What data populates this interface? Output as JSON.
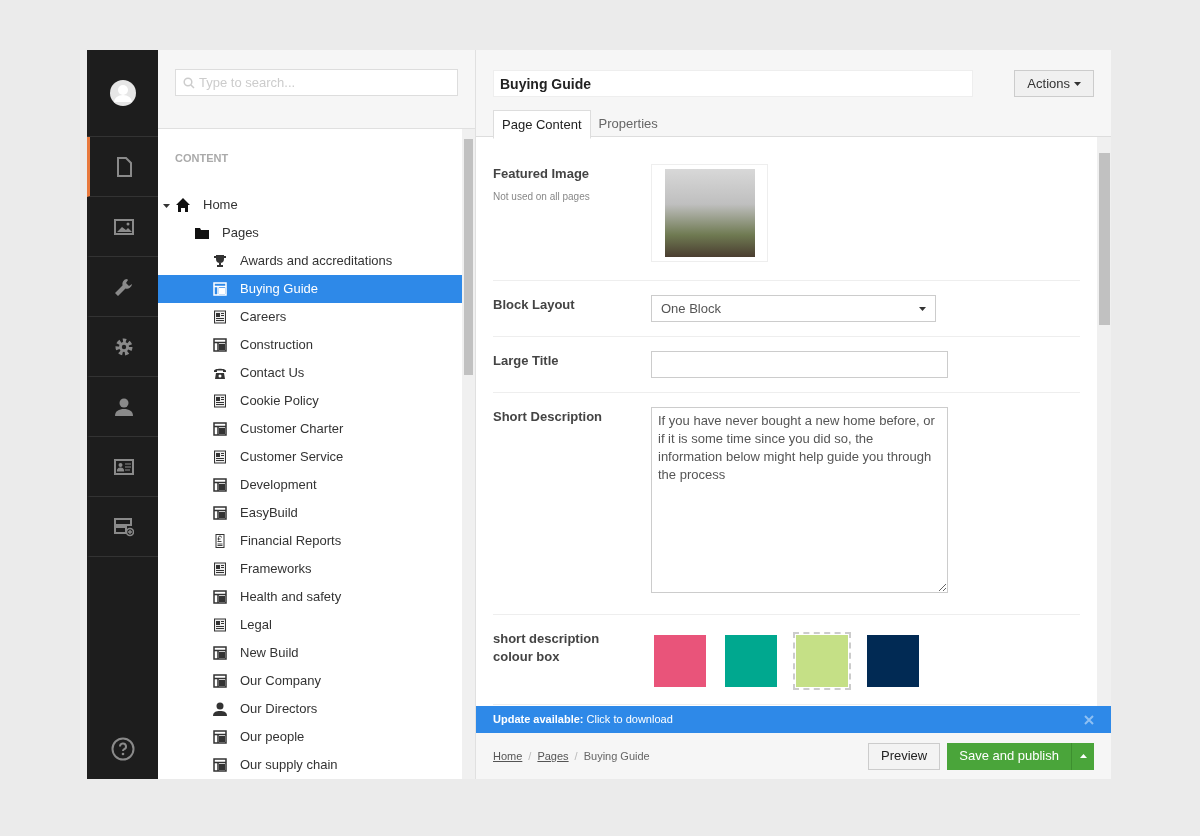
{
  "sidebar": {
    "sections": [
      {
        "kind": "document",
        "selected": true
      },
      {
        "kind": "image",
        "selected": false
      },
      {
        "kind": "wrench",
        "selected": false
      },
      {
        "kind": "gear",
        "selected": false
      },
      {
        "kind": "person",
        "selected": false
      },
      {
        "kind": "card",
        "selected": false
      },
      {
        "kind": "server",
        "selected": false
      }
    ]
  },
  "search": {
    "placeholder": "Type to search..."
  },
  "tree": {
    "heading": "CONTENT",
    "items": [
      {
        "label": "Home",
        "kind": "home",
        "expanded": true,
        "selected": false,
        "children": [
          {
            "label": "Pages",
            "kind": "folder",
            "selected": false,
            "children": [
              {
                "label": "Awards and accreditations",
                "kind": "trophy",
                "selected": false
              },
              {
                "label": "Buying Guide",
                "kind": "layout",
                "selected": true
              },
              {
                "label": "Careers",
                "kind": "article",
                "selected": false
              },
              {
                "label": "Construction",
                "kind": "layout",
                "selected": false
              },
              {
                "label": "Contact Us",
                "kind": "phone",
                "selected": false
              },
              {
                "label": "Cookie Policy",
                "kind": "article",
                "selected": false
              },
              {
                "label": "Customer Charter",
                "kind": "layout",
                "selected": false
              },
              {
                "label": "Customer Service",
                "kind": "article",
                "selected": false
              },
              {
                "label": "Development",
                "kind": "layout",
                "selected": false
              },
              {
                "label": "EasyBuild",
                "kind": "layout",
                "selected": false
              },
              {
                "label": "Financial Reports",
                "kind": "pound",
                "selected": false
              },
              {
                "label": "Frameworks",
                "kind": "article",
                "selected": false
              },
              {
                "label": "Health and safety",
                "kind": "layout",
                "selected": false
              },
              {
                "label": "Legal",
                "kind": "article",
                "selected": false
              },
              {
                "label": "New Build",
                "kind": "layout",
                "selected": false
              },
              {
                "label": "Our Company",
                "kind": "layout",
                "selected": false
              },
              {
                "label": "Our Directors",
                "kind": "person",
                "selected": false
              },
              {
                "label": "Our people",
                "kind": "layout",
                "selected": false
              },
              {
                "label": "Our supply chain",
                "kind": "layout",
                "selected": false
              }
            ]
          }
        ]
      }
    ]
  },
  "editor": {
    "title": "Buying Guide",
    "actions": "Actions",
    "tabs": [
      {
        "label": "Page Content",
        "selected": true
      },
      {
        "label": "Properties",
        "selected": false
      }
    ],
    "fields": [
      {
        "kind": "image",
        "label": "Featured Image",
        "description": "Not used on all pages"
      },
      {
        "kind": "dropdown",
        "label": "Block Layout",
        "value": "One Block"
      },
      {
        "kind": "text",
        "label": "Large Title"
      },
      {
        "kind": "textarea",
        "label": "Short Description",
        "value": "If you have never bought a new home before, or if it is some time since you did so, the information below might help guide you through the process"
      },
      {
        "kind": "colors",
        "label": "short description colour box",
        "options": [
          {
            "color": "#e9547a",
            "selected": false
          },
          {
            "color": "#00a88f",
            "selected": false
          },
          {
            "color": "#c5e086",
            "selected": true
          },
          {
            "color": "#012a54",
            "selected": false
          }
        ]
      }
    ]
  },
  "notification": {
    "text": "**Update available:** Click to download"
  },
  "footer": {
    "separator": "/",
    "breadcrumbs": [
      {
        "label": "Home",
        "link": true
      },
      {
        "label": "Pages",
        "link": true
      },
      {
        "label": "Buying Guide",
        "link": false
      }
    ],
    "preview": "Preview",
    "save": "Save and publish"
  }
}
